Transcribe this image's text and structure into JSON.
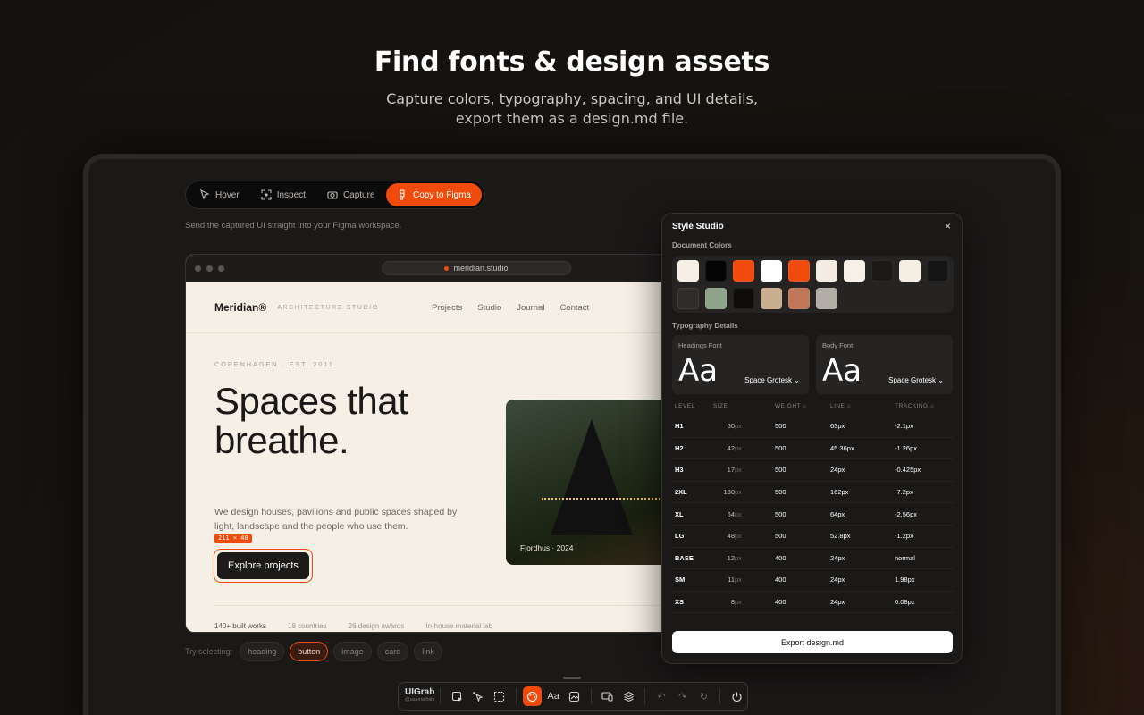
{
  "hero": {
    "title": "Find fonts & design assets",
    "subtitle_line1": "Capture colors, typography, spacing, and UI details,",
    "subtitle_line2": "export them as a design.md file."
  },
  "modebar": {
    "hover": "Hover",
    "inspect": "Inspect",
    "capture": "Capture",
    "copy_figma": "Copy to Figma"
  },
  "helper_text": "Send the captured UI straight into your Figma workspace.",
  "browser": {
    "url": "meridian.studio",
    "site": {
      "brand": "Meridian®",
      "tagline": "ARCHITECTURE STUDIO",
      "nav": [
        "Projects",
        "Studio",
        "Journal",
        "Contact"
      ],
      "eyebrow": "COPENHAGEN · EST. 2011",
      "headline": "Spaces that breathe.",
      "body": "We design houses, pavilions and public spaces shaped by light, landscape and the people who use them.",
      "selection_dims": "211 × 48",
      "cta": "Explore projects",
      "photo_caption": "Fjordhus · 2024",
      "stats": [
        "140+ built works",
        "18 countries",
        "26 design awards",
        "In-house material lab"
      ]
    }
  },
  "chips": {
    "label": "Try selecting:",
    "items": [
      "heading",
      "button",
      "image",
      "card",
      "link"
    ],
    "selected": "button"
  },
  "panel": {
    "title": "Style Studio",
    "close": "×",
    "colors_label": "Document Colors",
    "colors": [
      "#f5efe5",
      "#050505",
      "#f04a0c",
      "#ffffff",
      "#f04a0c",
      "#f2ece2",
      "#f6f0e6",
      "#1c1a16",
      "#f5efe3",
      "#141414",
      "#2e2d2b",
      "#8ea389",
      "#0d0c0b",
      "#c9ae8f",
      "#c27659",
      "#b1ada6"
    ],
    "typography_label": "Typography Details",
    "headings": {
      "label": "Headings Font",
      "sample": "Aa",
      "font": "Space Grotesk"
    },
    "body": {
      "label": "Body Font",
      "sample": "Aa",
      "font": "Space Grotesk"
    },
    "table_headers": [
      "LEVEL",
      "SIZE",
      "WEIGHT",
      "LINE",
      "TRACKING"
    ],
    "rows": [
      {
        "level": "H1",
        "size": "60",
        "unit": "px",
        "weight": "500",
        "line": "63px",
        "tracking": "-2.1px"
      },
      {
        "level": "H2",
        "size": "42",
        "unit": "px",
        "weight": "500",
        "line": "45.36px",
        "tracking": "-1.26px"
      },
      {
        "level": "H3",
        "size": "17",
        "unit": "px",
        "weight": "500",
        "line": "24px",
        "tracking": "-0.425px"
      },
      {
        "level": "2XL",
        "size": "180",
        "unit": "px",
        "weight": "500",
        "line": "162px",
        "tracking": "-7.2px"
      },
      {
        "level": "XL",
        "size": "64",
        "unit": "px",
        "weight": "500",
        "line": "64px",
        "tracking": "-2.56px"
      },
      {
        "level": "LG",
        "size": "48",
        "unit": "px",
        "weight": "500",
        "line": "52.8px",
        "tracking": "-1.2px"
      },
      {
        "level": "BASE",
        "size": "12",
        "unit": "px",
        "weight": "400",
        "line": "24px",
        "tracking": "normal"
      },
      {
        "level": "SM",
        "size": "11",
        "unit": "px",
        "weight": "400",
        "line": "24px",
        "tracking": "1.98px"
      },
      {
        "level": "XS",
        "size": "8",
        "unit": "px",
        "weight": "400",
        "line": "24px",
        "tracking": "0.08px"
      }
    ],
    "export_label": "Export design.md"
  },
  "dock": {
    "name": "UIGrab",
    "handle": "@usamaifolio",
    "typography_glyph": "Aa"
  },
  "colors": {
    "accent": "#f04a0c",
    "page_bg": "#141211",
    "site_bg": "#f5efe5"
  }
}
